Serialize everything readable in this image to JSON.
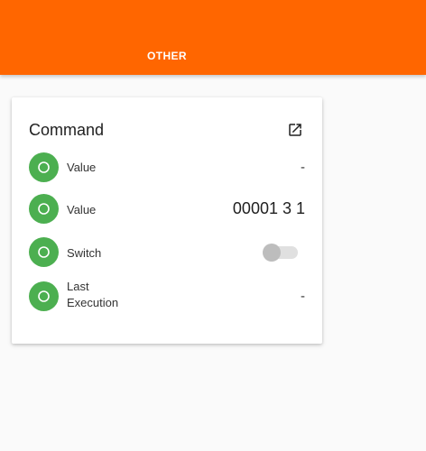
{
  "header": {
    "tabs": [
      {
        "label": "OTHER"
      }
    ],
    "accent_color": "#ff6600"
  },
  "card": {
    "title": "Command",
    "action_icon": "open-in-new-icon",
    "rows": [
      {
        "icon": "circle-icon",
        "label": "Value",
        "value": "-"
      },
      {
        "icon": "circle-icon",
        "label": "Value",
        "value": "00001 3 1"
      },
      {
        "icon": "circle-icon",
        "label": "Switch",
        "switch_on": false
      },
      {
        "icon": "circle-icon",
        "label_line1": "Last",
        "label_line2": "Execution",
        "value": "-"
      }
    ],
    "icon_color": "#4caf50"
  }
}
